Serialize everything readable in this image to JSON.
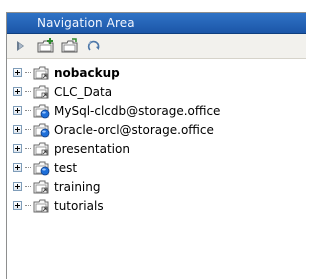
{
  "panel": {
    "title": "Navigation Area"
  },
  "toolbar": {
    "buttons": [
      {
        "name": "collapse-all-button",
        "icon": "arrow-collapse-icon"
      },
      {
        "name": "new-folder-button",
        "icon": "new-folder-icon"
      },
      {
        "name": "new-subfolder-button",
        "icon": "subfolder-icon"
      },
      {
        "name": "refresh-button",
        "icon": "refresh-icon"
      }
    ]
  },
  "tree": {
    "items": [
      {
        "label": "nobackup",
        "bold": true,
        "icon": "folder-icon"
      },
      {
        "label": "CLC_Data",
        "bold": false,
        "icon": "folder-icon"
      },
      {
        "label": "MySql-clcdb@storage.office",
        "bold": false,
        "icon": "database-folder-icon"
      },
      {
        "label": "Oracle-orcl@storage.office",
        "bold": false,
        "icon": "database-folder-icon"
      },
      {
        "label": "presentation",
        "bold": false,
        "icon": "folder-icon"
      },
      {
        "label": "test",
        "bold": false,
        "icon": "database-folder-icon"
      },
      {
        "label": "training",
        "bold": false,
        "icon": "folder-icon"
      },
      {
        "label": "tutorials",
        "bold": false,
        "icon": "folder-icon"
      }
    ]
  },
  "colors": {
    "titlebar": "#1f5fb3",
    "toolbar": "#f2f1ed",
    "db_badge": "#1e6fd9"
  }
}
